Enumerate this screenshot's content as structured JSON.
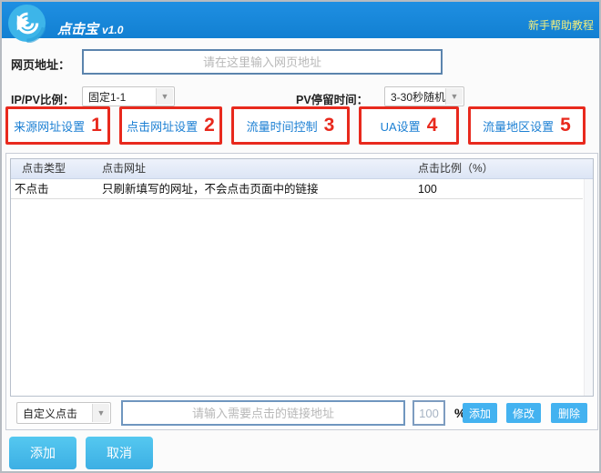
{
  "window": {
    "title": "点击宝",
    "version": "v1.0",
    "help_link": "新手帮助教程"
  },
  "icons": {
    "dropdown_arrow": "▼",
    "logo": "play-refresh"
  },
  "form": {
    "url_label": "网页地址：",
    "url_placeholder": "请在这里输入网页地址",
    "ip_pv_label": "IP/PV比例：",
    "ip_pv_value": "固定1-1",
    "pv_stay_label": "PV停留时间：",
    "pv_stay_value": "3-30秒随机"
  },
  "tabs": [
    {
      "label": "来源网址设置",
      "number": "1"
    },
    {
      "label": "点击网址设置",
      "number": "2"
    },
    {
      "label": "流量时间控制",
      "number": "3"
    },
    {
      "label": "UA设置",
      "number": "4"
    },
    {
      "label": "流量地区设置",
      "number": "5"
    }
  ],
  "table": {
    "headers": [
      "点击类型",
      "点击网址",
      "点击比例（%）"
    ],
    "rows": [
      {
        "type": "不点击",
        "url": "只刷新填写的网址，不会点击页面中的链接",
        "ratio": "100"
      }
    ]
  },
  "row_editor": {
    "click_type_value": "自定义点击",
    "url_placeholder": "请输入需要点击的链接地址",
    "percent_value": "100",
    "percent_sign": "%",
    "add_label": "添加",
    "modify_label": "修改",
    "delete_label": "删除"
  },
  "footer": {
    "add_label": "添加",
    "cancel_label": "取消"
  },
  "colors": {
    "header_blue": "#1787d9",
    "accent_red": "#e8291d",
    "link_yellow": "#f2ee7d",
    "tab_text_blue": "#1b7fd3",
    "small_button_blue": "#43b2f0",
    "big_button_blue": "#46bdea",
    "input_border_blue": "#5b84ad",
    "table_header_bg": "#e3eaf7"
  }
}
